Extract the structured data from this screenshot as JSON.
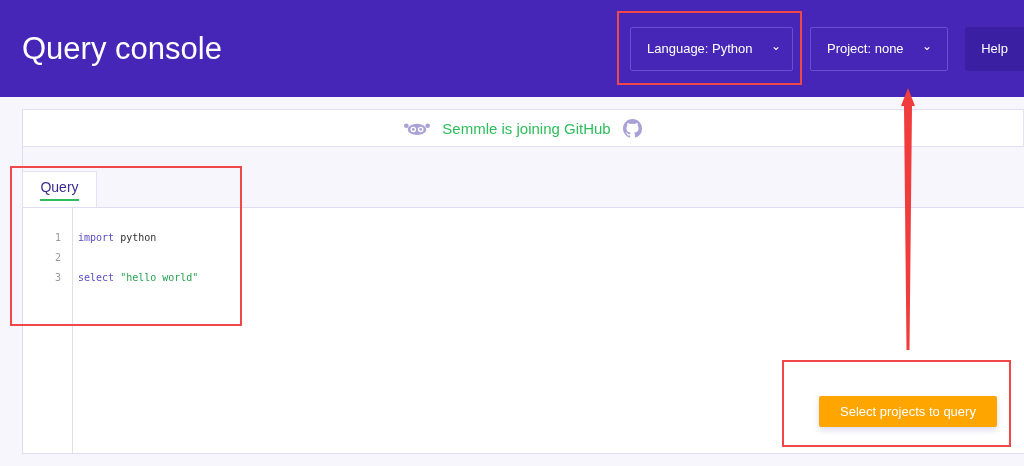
{
  "header": {
    "title": "Query console",
    "dropdowns": [
      {
        "label": "Language:",
        "value": "Python",
        "caret": "⌄",
        "highlighted": true,
        "pointed_at": false
      },
      {
        "label": "Project:",
        "value": "none",
        "caret": "⌄",
        "highlighted": false,
        "pointed_at": true
      }
    ],
    "help_button": "Help"
  },
  "banner": {
    "text": "Semmle is joining GitHub"
  },
  "tabs": [
    {
      "label": "Query",
      "selected": true
    }
  ],
  "editor": {
    "highlighted": true,
    "lines": [
      {
        "number": "1",
        "tokens": [
          {
            "kind": "keyword",
            "text": "import"
          },
          {
            "kind": "plain",
            "text": "python"
          }
        ]
      },
      {
        "number": "2"
      },
      {
        "number": "3",
        "tokens": [
          {
            "kind": "keyword",
            "text": "select"
          },
          {
            "kind": "string",
            "text": "\"hello world\""
          }
        ]
      }
    ]
  },
  "run_button": {
    "label": "Select projects to query",
    "highlighted": true
  }
}
